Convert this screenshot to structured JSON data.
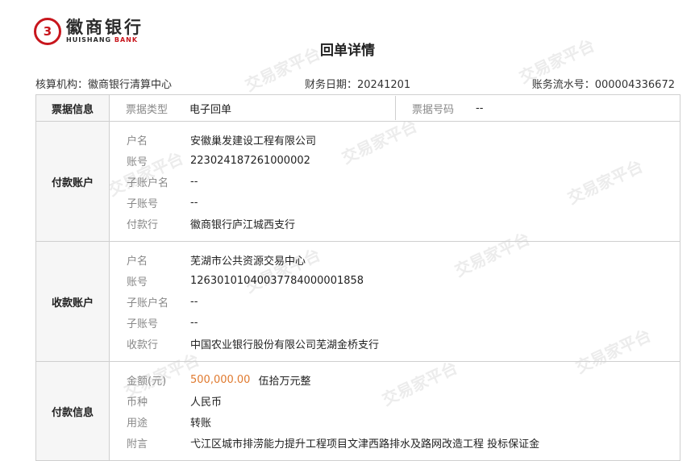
{
  "logo": {
    "mark": "3",
    "cn": "徽商银行",
    "en_main": "HUISHANG",
    "en_bank": "BANK"
  },
  "title": "回单详情",
  "meta": {
    "org": "核算机构：徽商银行清算中心",
    "date": "财务日期：20241201",
    "serial": "账务流水号：000004336672"
  },
  "receipt_info": {
    "head": "票据信息",
    "type_label": "票据类型",
    "type_value": "电子回单",
    "number_label": "票据号码",
    "number_value": "--"
  },
  "payer": {
    "head": "付款账户",
    "rows": [
      {
        "label": "户名",
        "value": "安徽巢发建设工程有限公司"
      },
      {
        "label": "账号",
        "value": "223024187261000002"
      },
      {
        "label": "子账户名",
        "value": "--"
      },
      {
        "label": "子账号",
        "value": "--"
      },
      {
        "label": "付款行",
        "value": "徽商银行庐江城西支行"
      }
    ]
  },
  "payee": {
    "head": "收款账户",
    "rows": [
      {
        "label": "户名",
        "value": "芜湖市公共资源交易中心"
      },
      {
        "label": "账号",
        "value": "12630101040037784000001858"
      },
      {
        "label": "子账户名",
        "value": "--"
      },
      {
        "label": "子账号",
        "value": "--"
      },
      {
        "label": "收款行",
        "value": "中国农业银行股份有限公司芜湖金桥支行"
      }
    ]
  },
  "payment": {
    "head": "付款信息",
    "amount_label": "金额(元)",
    "amount_value": "500,000.00",
    "amount_words": "伍拾万元整",
    "rows": [
      {
        "label": "币种",
        "value": "人民币"
      },
      {
        "label": "用途",
        "value": "转账"
      },
      {
        "label": "附言",
        "value": "弋江区城市排涝能力提升工程项目文津西路排水及路网改造工程 投标保证金"
      }
    ]
  },
  "watermark": "交易家平台"
}
